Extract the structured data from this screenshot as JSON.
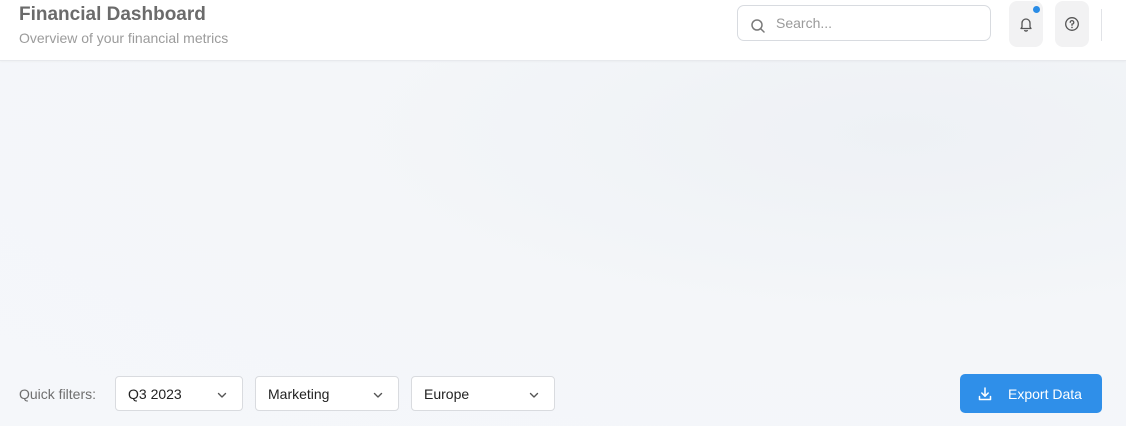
{
  "header": {
    "title": "Financial Dashboard",
    "subtitle": "Overview of your financial metrics",
    "search": {
      "placeholder": "Search...",
      "value": ""
    },
    "notifications": {
      "icon": "bell-icon",
      "has_unread": true,
      "dot_color": "#2a8ce6"
    },
    "help": {
      "icon": "question-circle-icon"
    }
  },
  "filters": {
    "label": "Quick filters:",
    "period": {
      "value": "Q3 2023"
    },
    "department": {
      "value": "Marketing"
    },
    "region": {
      "value": "Europe"
    }
  },
  "actions": {
    "export": {
      "label": "Export Data",
      "icon": "download-icon",
      "color": "#2f8fe9"
    }
  }
}
